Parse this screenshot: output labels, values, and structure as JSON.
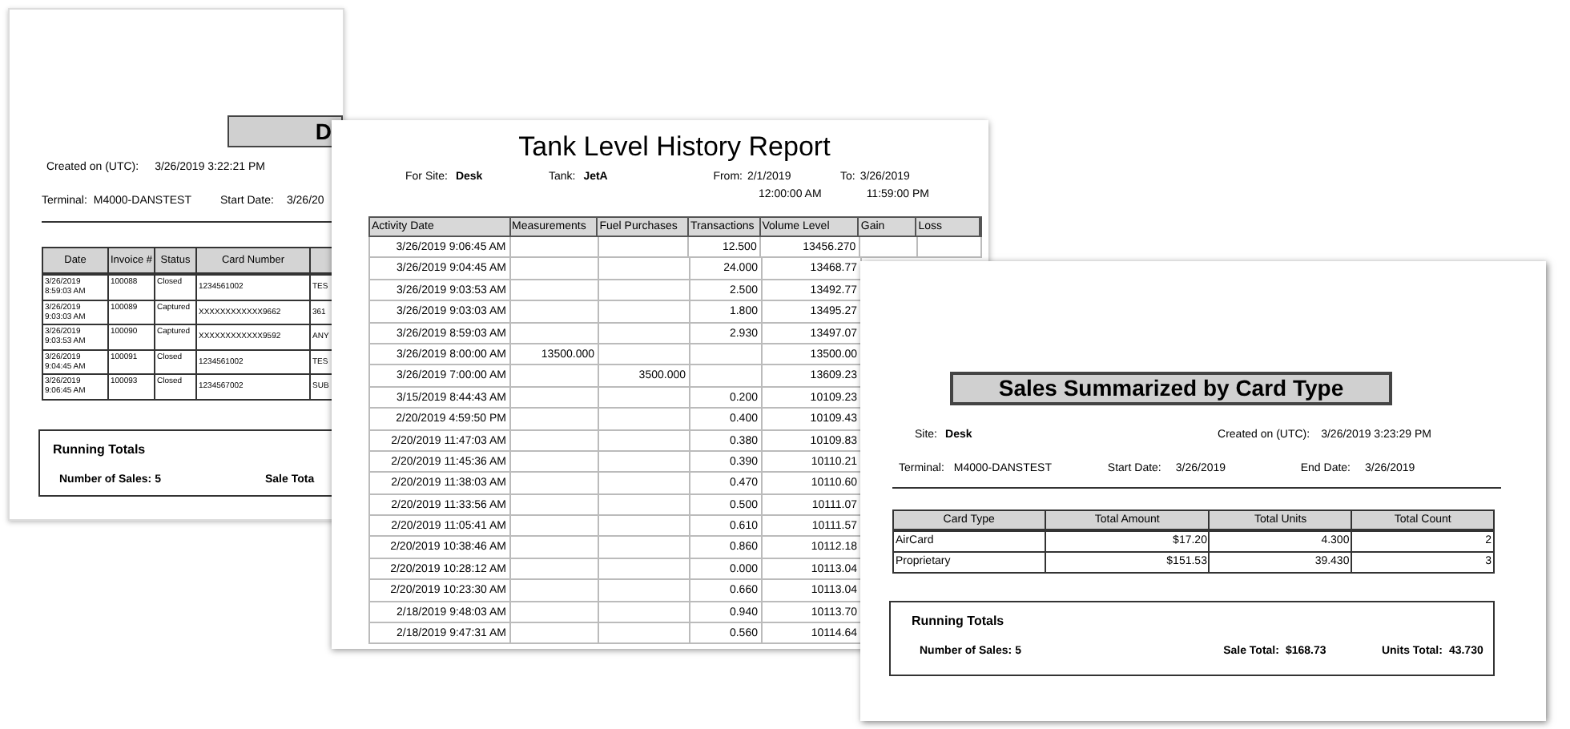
{
  "sales_detail_report": {
    "title": "D",
    "created_label": "Created on (UTC):",
    "created_value": "3/26/2019 3:22:21 PM",
    "terminal_label": "Terminal:",
    "terminal_value": "M4000-DANSTEST",
    "start_label": "Start Date:",
    "start_value": "3/26/20",
    "columns": [
      "Date",
      "Invoice #",
      "Status",
      "Card Number"
    ],
    "rows": [
      {
        "date": "3/26/2019 8:59:03 AM",
        "invoice": "100088",
        "status": "Closed",
        "card": "1234561002",
        "column_5": "TES"
      },
      {
        "date": "3/26/2019 9:03:03 AM",
        "invoice": "100089",
        "status": "Captured",
        "card": "XXXXXXXXXXXX9662",
        "column_5": "361"
      },
      {
        "date": "3/26/2019 9:03:53 AM",
        "invoice": "100090",
        "status": "Captured",
        "card": "XXXXXXXXXXXX9592",
        "column_5": "ANY"
      },
      {
        "date": "3/26/2019 9:04:45 AM",
        "invoice": "100091",
        "status": "Closed",
        "card": "1234561002",
        "column_5": "TES"
      },
      {
        "date": "3/26/2019 9:06:45 AM",
        "invoice": "100093",
        "status": "Closed",
        "card": "1234567002",
        "column_5": "SUB"
      }
    ],
    "running_totals": {
      "title": "Running Totals",
      "sales_label": "Number of Sales:",
      "sales_value": "5",
      "sale_total_label": "Sale Tota"
    }
  },
  "tank_level_report": {
    "title": "Tank Level History Report",
    "site_label": "For Site:",
    "site_value": "Desk",
    "tank_label": "Tank:",
    "tank_value": "JetA",
    "from_label": "From:",
    "from_date": "2/1/2019",
    "from_time": "12:00:00 AM",
    "to_label": "To:",
    "to_date": "3/26/2019",
    "to_time": "11:59:00 PM",
    "columns": [
      "Activity Date",
      "Measurements",
      "Fuel Purchases",
      "Transactions",
      "Volume Level",
      "Gain",
      "Loss"
    ],
    "rows": [
      {
        "date": "3/26/2019 9:06:45 AM",
        "measurement": "",
        "fuel": "",
        "transactions": "12.500",
        "volume": "13456.270"
      },
      {
        "date": "3/26/2019 9:04:45 AM",
        "transactions": "24.000",
        "volume": "13468.77"
      },
      {
        "date": "3/26/2019 9:03:53 AM",
        "transactions": "2.500",
        "volume": "13492.77"
      },
      {
        "date": "3/26/2019 9:03:03 AM",
        "transactions": "1.800",
        "volume": "13495.27"
      },
      {
        "date": "3/26/2019 8:59:03 AM",
        "transactions": "2.930",
        "volume": "13497.07"
      },
      {
        "date": "3/26/2019 8:00:00 AM",
        "measurement": "13500.000",
        "volume": "13500.00"
      },
      {
        "date": "3/26/2019 7:00:00 AM",
        "fuel": "3500.000",
        "volume": "13609.23"
      },
      {
        "date": "3/15/2019 8:44:43 AM",
        "transactions": "0.200",
        "volume": "10109.23"
      },
      {
        "date": "2/20/2019 4:59:50 PM",
        "transactions": "0.400",
        "volume": "10109.43"
      },
      {
        "date": "2/20/2019 11:47:03 AM",
        "transactions": "0.380",
        "volume": "10109.83"
      },
      {
        "date": "2/20/2019 11:45:36 AM",
        "transactions": "0.390",
        "volume": "10110.21"
      },
      {
        "date": "2/20/2019 11:38:03 AM",
        "transactions": "0.470",
        "volume": "10110.60"
      },
      {
        "date": "2/20/2019 11:33:56 AM",
        "transactions": "0.500",
        "volume": "10111.07"
      },
      {
        "date": "2/20/2019 11:05:41 AM",
        "transactions": "0.610",
        "volume": "10111.57"
      },
      {
        "date": "2/20/2019 10:38:46 AM",
        "transactions": "0.860",
        "volume": "10112.18"
      },
      {
        "date": "2/20/2019 10:28:12 AM",
        "transactions": "0.000",
        "volume": "10113.04"
      },
      {
        "date": "2/20/2019 10:23:30 AM",
        "transactions": "0.660",
        "volume": "10113.04"
      },
      {
        "date": "2/18/2019 9:48:03 AM",
        "transactions": "0.940",
        "volume": "10113.70"
      },
      {
        "date": "2/18/2019 9:47:31 AM",
        "transactions": "0.560",
        "volume": "10114.64"
      }
    ]
  },
  "card_type_summary": {
    "title": "Sales Summarized by Card Type",
    "site_label": "Site:",
    "site_value": "Desk",
    "created_label": "Created on (UTC):",
    "created_value": "3/26/2019 3:23:29 PM",
    "terminal_label": "Terminal:",
    "terminal_value": "M4000-DANSTEST",
    "start_label": "Start Date:",
    "start_value": "3/26/2019",
    "end_label": "End Date:",
    "end_value": "3/26/2019",
    "columns": [
      "Card Type",
      "Total Amount",
      "Total Units",
      "Total Count"
    ],
    "rows": [
      [
        "AirCard",
        "$17.20",
        "4.300",
        "2"
      ],
      [
        "Proprietary",
        "$151.53",
        "39.430",
        "3"
      ]
    ],
    "running_totals": {
      "title": "Running Totals",
      "sales_label": "Number of Sales:",
      "sales_value": "5",
      "sale_total_label": "Sale Total:",
      "sale_total_value": "$168.73",
      "units_label": "Units Total:",
      "units_value": "43.730"
    }
  }
}
